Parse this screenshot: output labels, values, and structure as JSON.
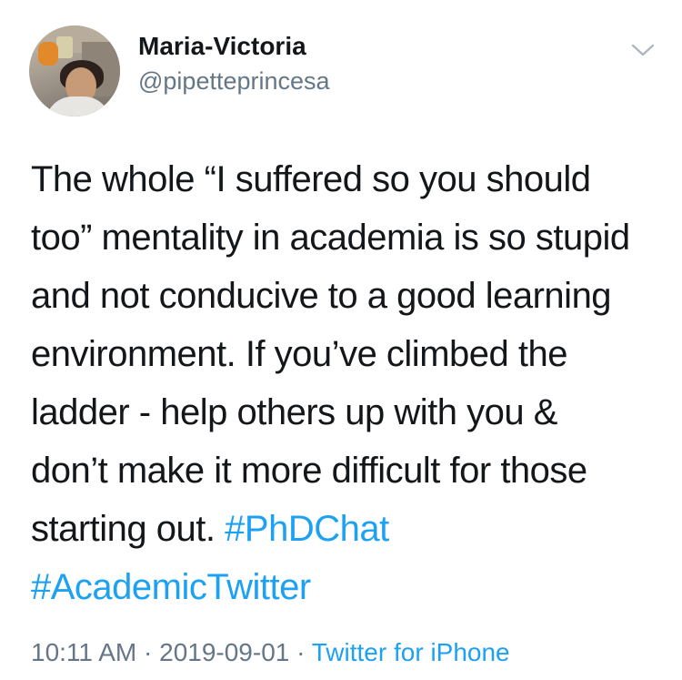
{
  "user": {
    "display_name": "Maria-Victoria",
    "handle": "@pipetteprincesa"
  },
  "tweet": {
    "lines": [
      "The whole “I suffered so you should",
      "too” mentality in academia is so stupid",
      "and not conducive to a good learning",
      "environment. If you’ve climbed the",
      "ladder - help others up with you &",
      "don’t make it more difficult for those",
      "starting out."
    ],
    "hashtags": [
      "#PhDChat",
      "#AcademicTwitter"
    ]
  },
  "meta": {
    "time": "10:11 AM",
    "separator": "·",
    "date": "2019-09-01",
    "source": "Twitter for iPhone"
  },
  "icons": {
    "menu": "chevron-down-icon"
  },
  "colors": {
    "link": "#1da1f2",
    "secondary_text": "#657786",
    "primary_text": "#14171a"
  }
}
